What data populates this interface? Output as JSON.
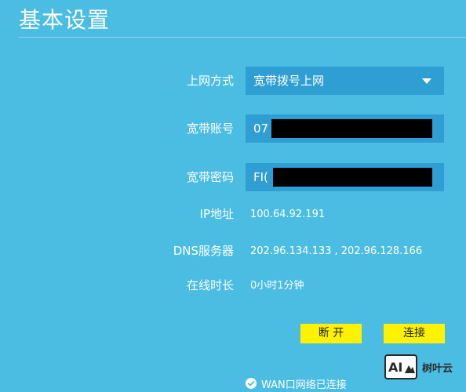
{
  "page": {
    "title": "基本设置"
  },
  "form": {
    "connection_type": {
      "label": "上网方式",
      "value": "宽带拨号上网"
    },
    "account": {
      "label": "宽带账号",
      "value_visible": "07"
    },
    "password": {
      "label": "宽带密码",
      "value_visible": "FI("
    },
    "ip": {
      "label": "IP地址",
      "value": "100.64.92.191"
    },
    "dns": {
      "label": "DNS服务器",
      "value": "202.96.134.133 , 202.96.128.166"
    },
    "online_time": {
      "label": "在线时长",
      "value": "0小时1分钟"
    }
  },
  "buttons": {
    "disconnect": "断 开",
    "connect": "连接"
  },
  "status": {
    "text": "WAN口网络已连接"
  },
  "watermark": {
    "logo_text": "AI",
    "brand": "树叶云"
  },
  "colors": {
    "background": "#4bbde3",
    "field": "#2f9fd3",
    "button": "#fff200"
  }
}
